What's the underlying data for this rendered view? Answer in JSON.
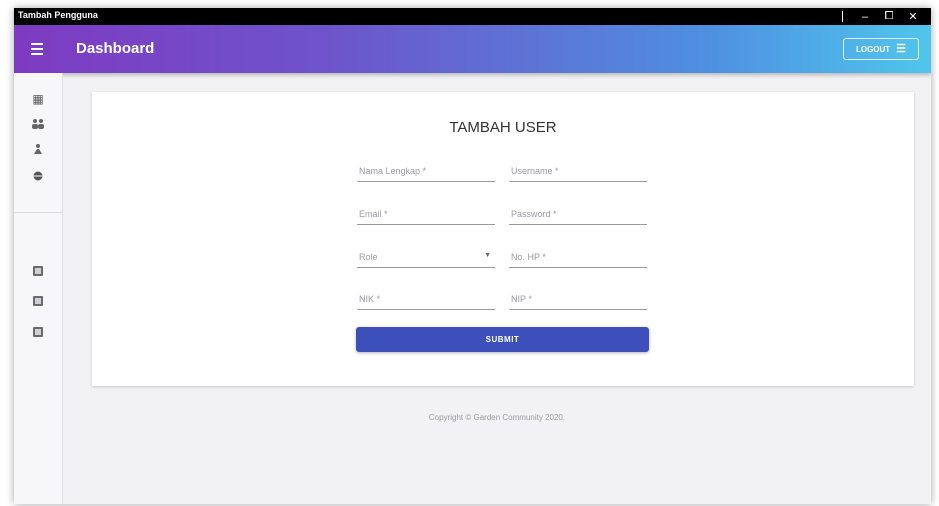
{
  "window": {
    "title": "Tambah Pengguna",
    "controls": {
      "minimize": "–",
      "maximize": "⧠",
      "close": "✕"
    }
  },
  "appbar": {
    "title": "Dashboard",
    "logout_label": "LOGOUT",
    "logout_icon": "exit-icon"
  },
  "sidebar": {
    "items": [
      {
        "name": "dashboard-icon",
        "glyph": "▦"
      },
      {
        "name": "users-icon",
        "glyph": "👥"
      },
      {
        "name": "person-icon",
        "glyph": "⛹"
      },
      {
        "name": "globe-icon",
        "glyph": "●"
      },
      {
        "name": "report-icon-1",
        "glyph": ""
      },
      {
        "name": "report-icon-2",
        "glyph": ""
      },
      {
        "name": "report-icon-3",
        "glyph": ""
      }
    ]
  },
  "form": {
    "title": "TAMBAH USER",
    "nama_lengkap": {
      "placeholder": "Nama Lengkap *"
    },
    "username": {
      "placeholder": "Username *"
    },
    "email": {
      "placeholder": "Email *"
    },
    "password": {
      "placeholder": "Password *"
    },
    "role": {
      "placeholder": "Role"
    },
    "no_hp": {
      "placeholder": "No. HP *"
    },
    "nik": {
      "placeholder": "NIK *"
    },
    "nip": {
      "placeholder": "NIP *"
    },
    "submit_label": "SUBMIT"
  },
  "footer": {
    "text": "Copyright © Garden Community 2020."
  }
}
